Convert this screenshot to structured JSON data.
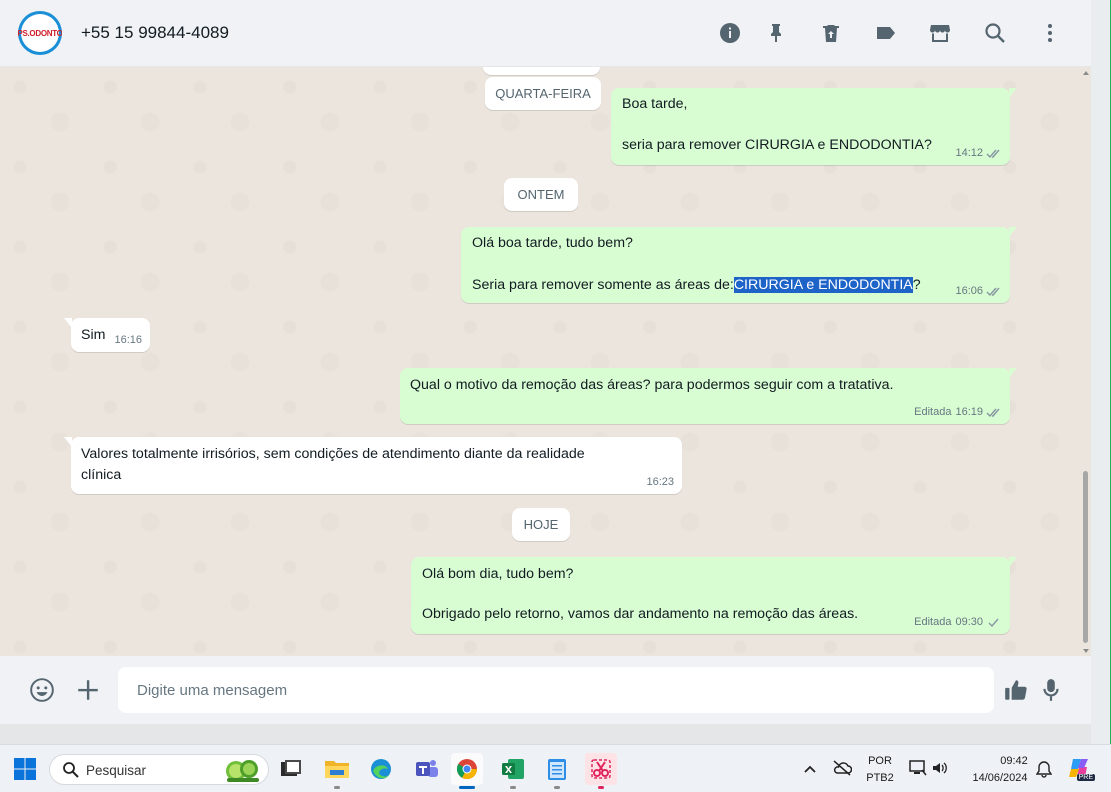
{
  "header": {
    "contact": "+55 15 99844-4089",
    "avatar_logo": "PS.ODONTO",
    "icons": [
      "info-icon",
      "pin-icon",
      "delete-icon",
      "label-icon",
      "store-icon",
      "search-icon",
      "menu-dots-icon"
    ]
  },
  "chat": {
    "dates": {
      "wednesday": "QUARTA-FEIRA",
      "yesterday": "ONTEM",
      "today": "HOJE"
    },
    "messages": [
      {
        "dir": "out",
        "lines": [
          "Boa tarde,",
          "seria para remover CIRURGIA e ENDODONTIA?"
        ],
        "time": "14:12",
        "ticks": "double"
      },
      {
        "dir": "out",
        "lines": [
          "Olá boa tarde, tudo bem?"
        ],
        "line2_prefix": "Seria para remover somente as áreas de:",
        "line2_highlight": "CIRURGIA e ENDODONTIA",
        "line2_suffix": "?",
        "time": "16:06",
        "ticks": "double"
      },
      {
        "dir": "in",
        "lines": [
          "Sim"
        ],
        "time": "16:16"
      },
      {
        "dir": "out",
        "lines": [
          "Qual o motivo da remoção das áreas? para podermos seguir com a tratativa."
        ],
        "edited": "Editada",
        "time": "16:19",
        "ticks": "double"
      },
      {
        "dir": "in",
        "lines": [
          "Valores totalmente irrisórios, sem condições de atendimento diante da realidade",
          "clínica"
        ],
        "time": "16:23"
      },
      {
        "dir": "out",
        "lines": [
          "Olá bom dia, tudo bem?",
          "Obrigado pelo retorno, vamos dar andamento na remoção das áreas."
        ],
        "edited": "Editada",
        "time": "09:30",
        "ticks": "single"
      }
    ]
  },
  "composer": {
    "placeholder": "Digite uma mensagem",
    "icons": [
      "emoji-icon",
      "plus-icon",
      "thumbs-up-icon",
      "microphone-icon"
    ]
  },
  "taskbar": {
    "search_label": "Pesquisar",
    "lang_line1": "POR",
    "lang_line2": "PTB2",
    "time": "09:42",
    "date": "14/06/2024",
    "copilot_badge": "PRE"
  },
  "colors": {
    "outgoing_bubble": "#d9fdd3",
    "incoming_bubble": "#ffffff",
    "selection": "#1e64c8",
    "accent_green": "#25b05a"
  }
}
